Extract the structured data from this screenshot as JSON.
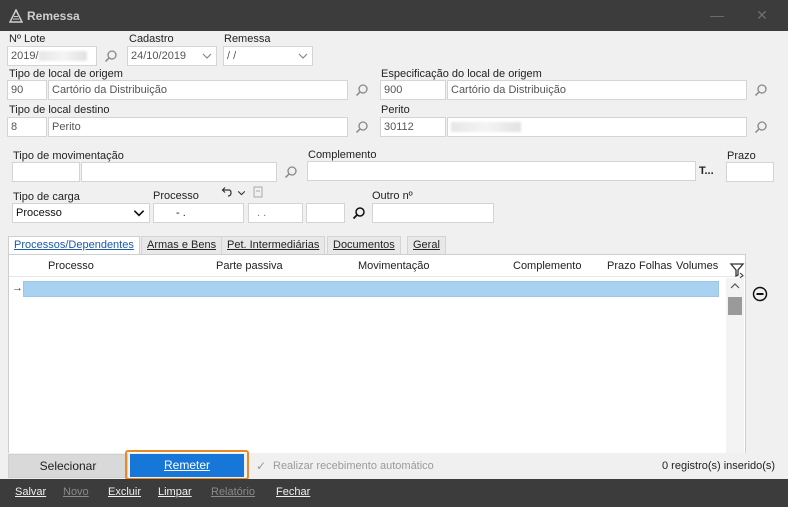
{
  "window": {
    "title": "Remessa"
  },
  "fields": {
    "lote": {
      "label": "Nº Lote",
      "value": "2019/"
    },
    "cadastro": {
      "label": "Cadastro",
      "value": "24/10/2019"
    },
    "remessa": {
      "label": "Remessa",
      "value": " /  /"
    },
    "origem_tipo": {
      "label": "Tipo de local de origem",
      "code": "90",
      "desc": "Cartório da Distribuição"
    },
    "origem_espec": {
      "label": "Especificação do local de origem",
      "code": "900",
      "desc": "Cartório da Distribuição"
    },
    "destino_tipo": {
      "label": "Tipo de local destino",
      "code": "8",
      "desc": "Perito"
    },
    "perito": {
      "label": "Perito",
      "code": "30112",
      "desc": ""
    },
    "movimentacao": {
      "label": "Tipo de movimentação",
      "code": "",
      "desc": ""
    },
    "complemento": {
      "label": "Complemento",
      "value": "",
      "button": "T..."
    },
    "prazo": {
      "label": "Prazo",
      "value": ""
    },
    "carga": {
      "label": "Tipo de carga",
      "value": "Processo"
    },
    "processo": {
      "label": "Processo",
      "part1": "-  .",
      "part2": ".  .",
      "part3": ""
    },
    "outro": {
      "label": "Outro nº",
      "value": ""
    }
  },
  "tabs": [
    {
      "label": "Processos/Dependentes"
    },
    {
      "label": "Armas e Bens"
    },
    {
      "label": "Pet. Intermediárias"
    },
    {
      "label": "Documentos"
    },
    {
      "label": "Geral"
    }
  ],
  "grid": {
    "columns": [
      "Processo",
      "Parte passiva",
      "Movimentação",
      "Complemento",
      "Prazo",
      "Folhas",
      "Volumes"
    ],
    "row_marker": "→"
  },
  "actions": {
    "selecionar": "Selecionar",
    "remeter": "Remeter",
    "auto_receive": "Realizar recebimento automático",
    "count": "0 registro(s) inserido(s)"
  },
  "bottom": {
    "salvar": "Salvar",
    "novo": "Novo",
    "excluir": "Excluir",
    "limpar": "Limpar",
    "relatorio": "Relatório",
    "fechar": "Fechar"
  },
  "colors": {
    "accent": "#1677d9",
    "highlight": "#e8892a",
    "titlebar": "#3c3c3c",
    "row_selected": "#a9d2f0"
  }
}
